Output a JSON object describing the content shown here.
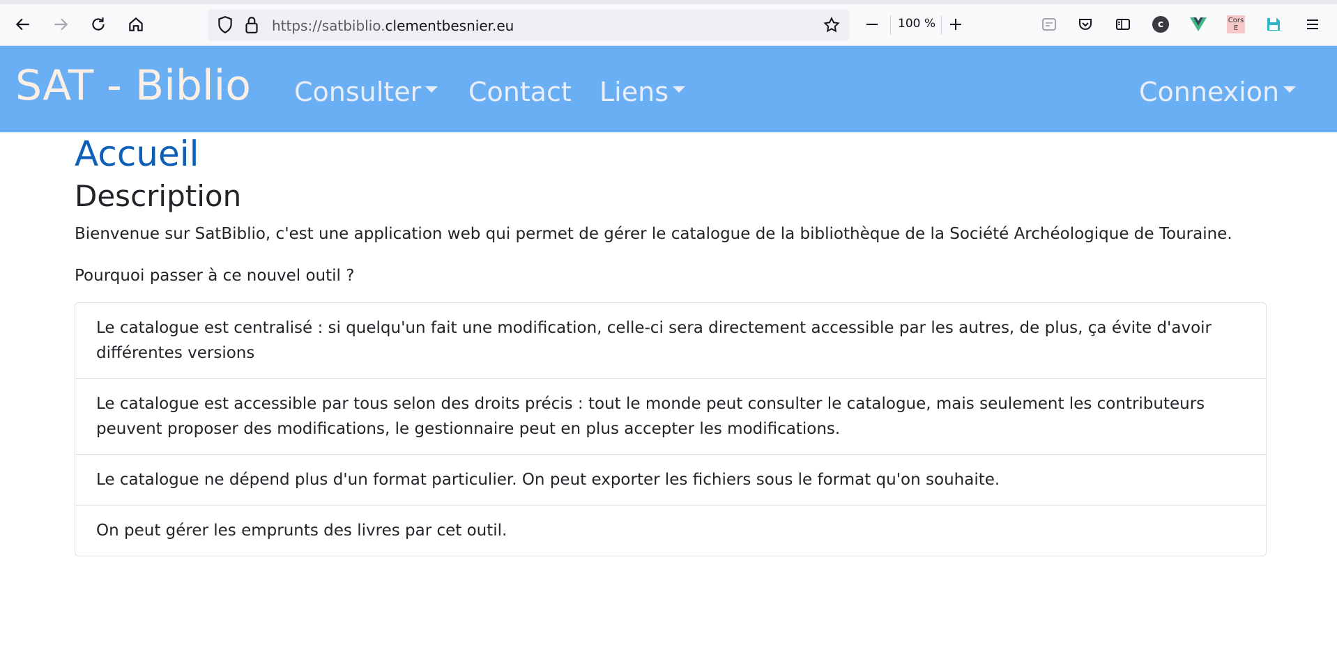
{
  "browser": {
    "url_dim": "https://satbiblio.",
    "url_main": "clementbesnier.eu",
    "zoom": "100 %",
    "icons": [
      "back-arrow-icon",
      "forward-arrow-icon",
      "reload-icon",
      "home-icon",
      "shield-icon",
      "lock-icon",
      "star-icon",
      "zoom-out-icon",
      "zoom-in-icon",
      "reader-view-icon",
      "pocket-icon",
      "sidebar-icon",
      "c-extension-icon",
      "vue-devtools-icon",
      "cors-extension-icon",
      "save-icon",
      "hamburger-menu-icon"
    ],
    "cors_label": [
      "Cors",
      "E"
    ],
    "c_ext_label": "c"
  },
  "navbar": {
    "brand": "SAT - Biblio",
    "consulter": "Consulter",
    "contact": "Contact",
    "liens": "Liens",
    "connexion": "Connexion",
    "colors": {
      "background": "#6aaef4",
      "brand": "#fcefe5",
      "links": "#e9eef8"
    }
  },
  "main": {
    "page_title": "Accueil",
    "section_title": "Description",
    "intro": "Bienvenue sur SatBiblio, c'est une application web qui permet de gérer le catalogue de la bibliothèque de la Société Archéologique de Touraine.",
    "question": "Pourquoi passer à ce nouvel outil ?",
    "items": [
      "Le catalogue est centralisé : si quelqu'un fait une modification, celle-ci sera directement accessible par les autres, de plus, ça évite d'avoir différentes versions",
      "Le catalogue est accessible par tous selon des droits précis : tout le monde peut consulter le catalogue, mais seulement les contributeurs peuvent proposer des modifications, le gestionnaire peut en plus accepter les modifications.",
      "Le catalogue ne dépend plus d'un format particulier. On peut exporter les fichiers sous le format qu'on souhaite.",
      "On peut gérer les emprunts des livres par cet outil."
    ],
    "colors": {
      "title": "#0d5fb8",
      "text": "#212529"
    }
  }
}
